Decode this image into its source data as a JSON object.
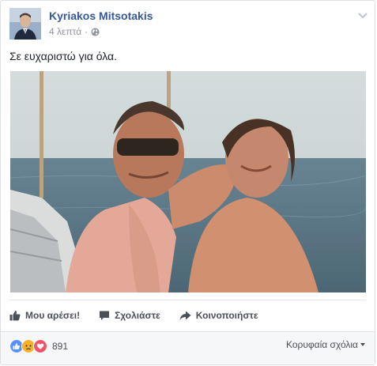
{
  "post": {
    "author": "Kyriakos Mitsotakis",
    "time": "4 λεπτά",
    "separator": "·",
    "audience_icon": "globe-icon",
    "menu_icon": "chevron-down-icon",
    "text": "Σε ευχαριστώ για όλα."
  },
  "actions": {
    "like_label": "Μου αρέσει!",
    "like_icon": "thumbs-up-icon",
    "comment_label": "Σχολιάστε",
    "comment_icon": "comment-icon",
    "share_label": "Κοινοποιήστε",
    "share_icon": "share-arrow-icon"
  },
  "footer": {
    "reactions": [
      "like",
      "sad",
      "love"
    ],
    "reaction_count": "891",
    "sort_label": "Κορυφαία σχόλια"
  },
  "colors": {
    "author_link": "#365899",
    "like_blue": "#5890ff",
    "sad_yellow": "#f7b125",
    "love_red": "#f25268",
    "footer_bg": "#f6f7f9"
  }
}
